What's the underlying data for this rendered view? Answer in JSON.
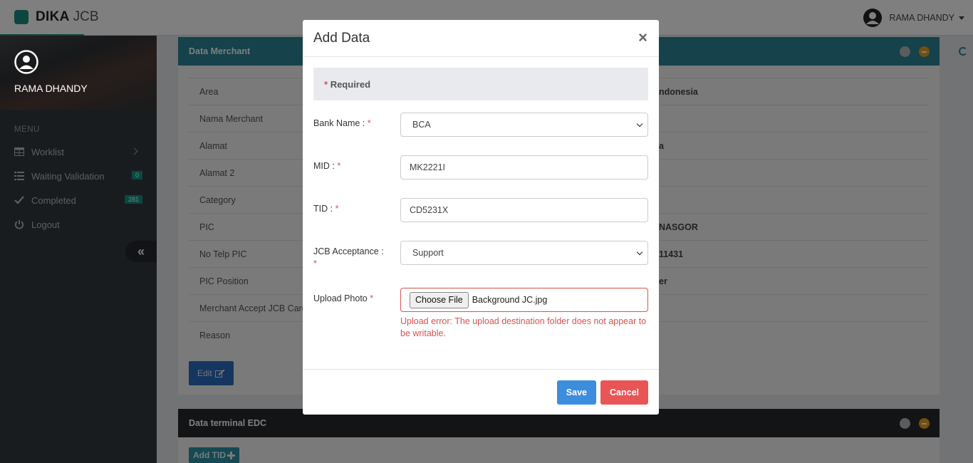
{
  "app": {
    "brand_strong": "DIKA",
    "brand_light": "JCB"
  },
  "topbar": {
    "user_name": "RAMA DHANDY"
  },
  "sidebar": {
    "user_name": "RAMA DHANDY",
    "menu_title": "MENU",
    "items": [
      {
        "label": "Worklist",
        "icon": "table-icon"
      },
      {
        "label": "Waiting Validation",
        "icon": "list-icon",
        "badge": "0"
      },
      {
        "label": "Completed",
        "icon": "check-icon",
        "badge": "281"
      },
      {
        "label": "Logout",
        "icon": "power-icon"
      }
    ],
    "collapse_glyph": "«"
  },
  "merchant_panel": {
    "title": "Data Merchant",
    "rows": [
      {
        "label": "Area",
        "value": "ndonesia"
      },
      {
        "label": "Nama Merchant",
        "value": ""
      },
      {
        "label": "Alamat",
        "value": "a"
      },
      {
        "label": "Alamat 2",
        "value": ""
      },
      {
        "label": "Category",
        "value": ""
      },
      {
        "label": "PIC",
        "value": "NASGOR"
      },
      {
        "label": "No Telp PIC",
        "value": "11431"
      },
      {
        "label": "PIC Position",
        "value": "er"
      },
      {
        "label": "Merchant Accept JCB Card",
        "value": ""
      },
      {
        "label": "Reason",
        "value": ""
      }
    ],
    "edit_label": "Edit"
  },
  "terminal_panel": {
    "title": "Data terminal EDC",
    "add_label": "Add TID"
  },
  "modal": {
    "title": "Add Data",
    "close_glyph": "×",
    "required_note": "Required",
    "required_star": "*",
    "fields": {
      "bank": {
        "label": "Bank Name :",
        "value": "BCA"
      },
      "mid": {
        "label": "MID :",
        "value": "MK2221I"
      },
      "tid": {
        "label": "TID :",
        "value": "CD5231X"
      },
      "jcb": {
        "label": "JCB Acceptance :",
        "value": "Support"
      },
      "photo": {
        "label": "Upload Photo",
        "button": "Choose File",
        "file_name": "Background JC.jpg"
      }
    },
    "error": "Upload error: The upload destination folder does not appear to be writable.",
    "save_label": "Save",
    "cancel_label": "Cancel"
  },
  "colors": {
    "accent": "#2b8597",
    "danger": "#d9534f",
    "primary": "#3c8dde",
    "sidebar": "#33383f"
  }
}
